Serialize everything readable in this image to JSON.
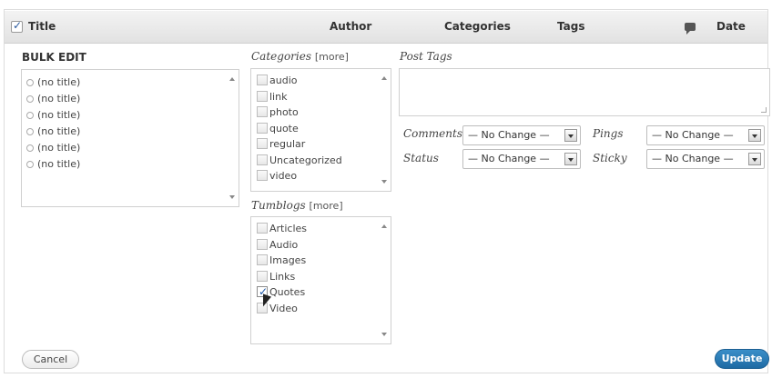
{
  "header": {
    "title_col": "Title",
    "author_col": "Author",
    "categories_col": "Categories",
    "tags_col": "Tags",
    "date_col": "Date"
  },
  "bulk_edit": {
    "heading": "BULK EDIT",
    "titles": [
      "(no title)",
      "(no title)",
      "(no title)",
      "(no title)",
      "(no title)",
      "(no title)"
    ]
  },
  "categories": {
    "label": "Categories",
    "more": "[more]",
    "items": [
      {
        "label": "audio",
        "checked": false
      },
      {
        "label": "link",
        "checked": false
      },
      {
        "label": "photo",
        "checked": false
      },
      {
        "label": "quote",
        "checked": false
      },
      {
        "label": "regular",
        "checked": false
      },
      {
        "label": "Uncategorized",
        "checked": false
      },
      {
        "label": "video",
        "checked": false
      }
    ]
  },
  "tumblogs": {
    "label": "Tumblogs",
    "more": "[more]",
    "items": [
      {
        "label": "Articles",
        "checked": false
      },
      {
        "label": "Audio",
        "checked": false
      },
      {
        "label": "Images",
        "checked": false
      },
      {
        "label": "Links",
        "checked": false
      },
      {
        "label": "Quotes",
        "checked": true
      },
      {
        "label": "Video",
        "checked": false
      }
    ]
  },
  "post_tags": {
    "label": "Post Tags",
    "value": ""
  },
  "fields": {
    "comments_label": "Comments",
    "comments_value": "— No Change —",
    "pings_label": "Pings",
    "pings_value": "— No Change —",
    "status_label": "Status",
    "status_value": "— No Change —",
    "sticky_label": "Sticky",
    "sticky_value": "— No Change —"
  },
  "buttons": {
    "cancel": "Cancel",
    "update": "Update"
  },
  "colors": {
    "update_button": "#1e6aa3",
    "checkmark": "#1a56a8"
  }
}
